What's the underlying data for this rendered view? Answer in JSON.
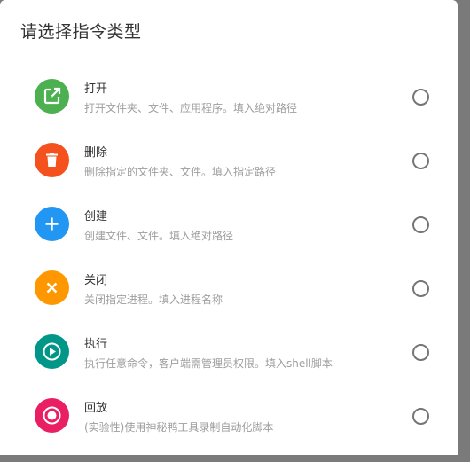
{
  "dialog": {
    "title": "请选择指令类型"
  },
  "options": [
    {
      "title": "打开",
      "desc": "打开文件夹、文件、应用程序。填入绝对路径",
      "icon": "open-in-new-icon",
      "color": "#4caf50"
    },
    {
      "title": "删除",
      "desc": "删除指定的文件夹、文件。填入指定路径",
      "icon": "trash-icon",
      "color": "#f4511e"
    },
    {
      "title": "创建",
      "desc": "创建文件、文件。填入绝对路径",
      "icon": "plus-icon",
      "color": "#2196f3"
    },
    {
      "title": "关闭",
      "desc": "关闭指定进程。填入进程名称",
      "icon": "close-icon",
      "color": "#ff9800"
    },
    {
      "title": "执行",
      "desc": "执行任意命令，客户端需管理员权限。填入shell脚本",
      "icon": "play-circle-icon",
      "color": "#009688"
    },
    {
      "title": "回放",
      "desc": "(实验性)使用神秘鸭工具录制自动化脚本",
      "icon": "record-icon",
      "color": "#e91e63"
    }
  ]
}
